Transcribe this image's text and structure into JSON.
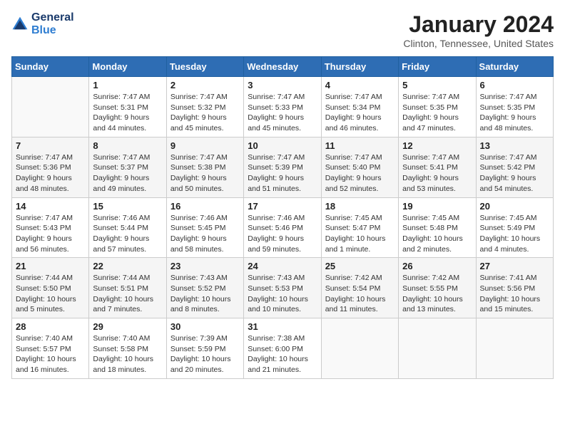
{
  "logo": {
    "line1": "General",
    "line2": "Blue"
  },
  "title": "January 2024",
  "subtitle": "Clinton, Tennessee, United States",
  "weekdays": [
    "Sunday",
    "Monday",
    "Tuesday",
    "Wednesday",
    "Thursday",
    "Friday",
    "Saturday"
  ],
  "weeks": [
    [
      {
        "day": "",
        "info": ""
      },
      {
        "day": "1",
        "info": "Sunrise: 7:47 AM\nSunset: 5:31 PM\nDaylight: 9 hours\nand 44 minutes."
      },
      {
        "day": "2",
        "info": "Sunrise: 7:47 AM\nSunset: 5:32 PM\nDaylight: 9 hours\nand 45 minutes."
      },
      {
        "day": "3",
        "info": "Sunrise: 7:47 AM\nSunset: 5:33 PM\nDaylight: 9 hours\nand 45 minutes."
      },
      {
        "day": "4",
        "info": "Sunrise: 7:47 AM\nSunset: 5:34 PM\nDaylight: 9 hours\nand 46 minutes."
      },
      {
        "day": "5",
        "info": "Sunrise: 7:47 AM\nSunset: 5:35 PM\nDaylight: 9 hours\nand 47 minutes."
      },
      {
        "day": "6",
        "info": "Sunrise: 7:47 AM\nSunset: 5:35 PM\nDaylight: 9 hours\nand 48 minutes."
      }
    ],
    [
      {
        "day": "7",
        "info": "Sunrise: 7:47 AM\nSunset: 5:36 PM\nDaylight: 9 hours\nand 48 minutes."
      },
      {
        "day": "8",
        "info": "Sunrise: 7:47 AM\nSunset: 5:37 PM\nDaylight: 9 hours\nand 49 minutes."
      },
      {
        "day": "9",
        "info": "Sunrise: 7:47 AM\nSunset: 5:38 PM\nDaylight: 9 hours\nand 50 minutes."
      },
      {
        "day": "10",
        "info": "Sunrise: 7:47 AM\nSunset: 5:39 PM\nDaylight: 9 hours\nand 51 minutes."
      },
      {
        "day": "11",
        "info": "Sunrise: 7:47 AM\nSunset: 5:40 PM\nDaylight: 9 hours\nand 52 minutes."
      },
      {
        "day": "12",
        "info": "Sunrise: 7:47 AM\nSunset: 5:41 PM\nDaylight: 9 hours\nand 53 minutes."
      },
      {
        "day": "13",
        "info": "Sunrise: 7:47 AM\nSunset: 5:42 PM\nDaylight: 9 hours\nand 54 minutes."
      }
    ],
    [
      {
        "day": "14",
        "info": "Sunrise: 7:47 AM\nSunset: 5:43 PM\nDaylight: 9 hours\nand 56 minutes."
      },
      {
        "day": "15",
        "info": "Sunrise: 7:46 AM\nSunset: 5:44 PM\nDaylight: 9 hours\nand 57 minutes."
      },
      {
        "day": "16",
        "info": "Sunrise: 7:46 AM\nSunset: 5:45 PM\nDaylight: 9 hours\nand 58 minutes."
      },
      {
        "day": "17",
        "info": "Sunrise: 7:46 AM\nSunset: 5:46 PM\nDaylight: 9 hours\nand 59 minutes."
      },
      {
        "day": "18",
        "info": "Sunrise: 7:45 AM\nSunset: 5:47 PM\nDaylight: 10 hours\nand 1 minute."
      },
      {
        "day": "19",
        "info": "Sunrise: 7:45 AM\nSunset: 5:48 PM\nDaylight: 10 hours\nand 2 minutes."
      },
      {
        "day": "20",
        "info": "Sunrise: 7:45 AM\nSunset: 5:49 PM\nDaylight: 10 hours\nand 4 minutes."
      }
    ],
    [
      {
        "day": "21",
        "info": "Sunrise: 7:44 AM\nSunset: 5:50 PM\nDaylight: 10 hours\nand 5 minutes."
      },
      {
        "day": "22",
        "info": "Sunrise: 7:44 AM\nSunset: 5:51 PM\nDaylight: 10 hours\nand 7 minutes."
      },
      {
        "day": "23",
        "info": "Sunrise: 7:43 AM\nSunset: 5:52 PM\nDaylight: 10 hours\nand 8 minutes."
      },
      {
        "day": "24",
        "info": "Sunrise: 7:43 AM\nSunset: 5:53 PM\nDaylight: 10 hours\nand 10 minutes."
      },
      {
        "day": "25",
        "info": "Sunrise: 7:42 AM\nSunset: 5:54 PM\nDaylight: 10 hours\nand 11 minutes."
      },
      {
        "day": "26",
        "info": "Sunrise: 7:42 AM\nSunset: 5:55 PM\nDaylight: 10 hours\nand 13 minutes."
      },
      {
        "day": "27",
        "info": "Sunrise: 7:41 AM\nSunset: 5:56 PM\nDaylight: 10 hours\nand 15 minutes."
      }
    ],
    [
      {
        "day": "28",
        "info": "Sunrise: 7:40 AM\nSunset: 5:57 PM\nDaylight: 10 hours\nand 16 minutes."
      },
      {
        "day": "29",
        "info": "Sunrise: 7:40 AM\nSunset: 5:58 PM\nDaylight: 10 hours\nand 18 minutes."
      },
      {
        "day": "30",
        "info": "Sunrise: 7:39 AM\nSunset: 5:59 PM\nDaylight: 10 hours\nand 20 minutes."
      },
      {
        "day": "31",
        "info": "Sunrise: 7:38 AM\nSunset: 6:00 PM\nDaylight: 10 hours\nand 21 minutes."
      },
      {
        "day": "",
        "info": ""
      },
      {
        "day": "",
        "info": ""
      },
      {
        "day": "",
        "info": ""
      }
    ]
  ]
}
